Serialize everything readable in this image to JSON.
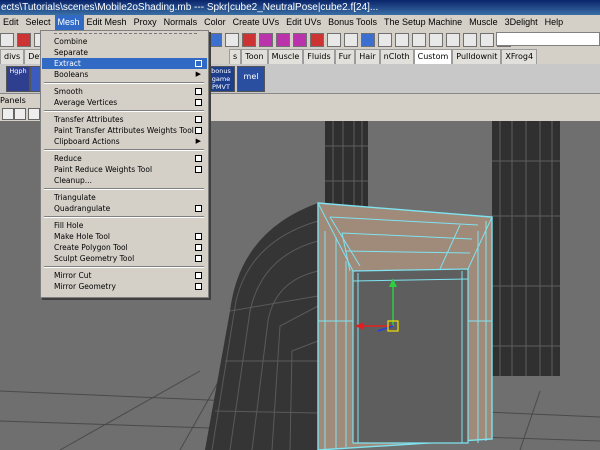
{
  "window": {
    "title": "ects\\Tutorials\\scenes\\Mobile2oShading.mb   ---   Spkr|cube2_NeutralPose|cube2.f[24]..."
  },
  "menubar": {
    "items": [
      {
        "label": "Edit"
      },
      {
        "label": "Select"
      },
      {
        "label": "Mesh"
      },
      {
        "label": "Edit Mesh"
      },
      {
        "label": "Proxy"
      },
      {
        "label": "Normals"
      },
      {
        "label": "Color"
      },
      {
        "label": "Create UVs"
      },
      {
        "label": "Edit UVs"
      },
      {
        "label": "Bonus Tools"
      },
      {
        "label": "The Setup Machine"
      },
      {
        "label": "Muscle"
      },
      {
        "label": "3Delight"
      },
      {
        "label": "Help"
      }
    ],
    "active_label": "Mesh"
  },
  "shelf_tabs": {
    "left": [
      {
        "label": "divs"
      },
      {
        "label": "Deform"
      }
    ],
    "right": [
      {
        "label": "s"
      },
      {
        "label": "Toon"
      },
      {
        "label": "Muscle"
      },
      {
        "label": "Fluids"
      },
      {
        "label": "Fur"
      },
      {
        "label": "Hair"
      },
      {
        "label": "nCloth"
      },
      {
        "label": "Custom"
      },
      {
        "label": "Pulldownit"
      },
      {
        "label": "XFrog4"
      }
    ],
    "selected_label": "Custom"
  },
  "shelf": {
    "left_btn": "Hgph",
    "bonus_btn": "bonus game PMVT",
    "mel_btn": "mel"
  },
  "panel_menu": {
    "label": "Panels"
  },
  "mesh_menu": {
    "items": [
      {
        "label": "Combine",
        "option": false,
        "submenu": false,
        "highlight": false
      },
      {
        "label": "Separate",
        "option": false,
        "submenu": false,
        "highlight": false
      },
      {
        "label": "Extract",
        "option": true,
        "submenu": false,
        "highlight": true
      },
      {
        "label": "Booleans",
        "option": false,
        "submenu": true,
        "highlight": false
      },
      {
        "label": "Smooth",
        "option": true,
        "submenu": false,
        "highlight": false
      },
      {
        "label": "Average Vertices",
        "option": true,
        "submenu": false,
        "highlight": false
      },
      {
        "label": "Transfer Attributes",
        "option": true,
        "submenu": false,
        "highlight": false
      },
      {
        "label": "Paint Transfer Attributes Weights Tool",
        "option": true,
        "submenu": false,
        "highlight": false
      },
      {
        "label": "Clipboard Actions",
        "option": false,
        "submenu": true,
        "highlight": false
      },
      {
        "label": "Reduce",
        "option": true,
        "submenu": false,
        "highlight": false
      },
      {
        "label": "Paint Reduce Weights Tool",
        "option": true,
        "submenu": false,
        "highlight": false
      },
      {
        "label": "Cleanup...",
        "option": false,
        "submenu": false,
        "highlight": false
      },
      {
        "label": "Triangulate",
        "option": false,
        "submenu": false,
        "highlight": false
      },
      {
        "label": "Quadrangulate",
        "option": true,
        "submenu": false,
        "highlight": false
      },
      {
        "label": "Fill Hole",
        "option": false,
        "submenu": false,
        "highlight": false
      },
      {
        "label": "Make Hole Tool",
        "option": true,
        "submenu": false,
        "highlight": false
      },
      {
        "label": "Create Polygon Tool",
        "option": true,
        "submenu": false,
        "highlight": false
      },
      {
        "label": "Sculpt Geometry Tool",
        "option": true,
        "submenu": false,
        "highlight": false
      },
      {
        "label": "Mirror Cut",
        "option": true,
        "submenu": false,
        "highlight": false
      },
      {
        "label": "Mirror Geometry",
        "option": true,
        "submenu": false,
        "highlight": false
      }
    ]
  },
  "colors": {
    "menu_highlight": "#316ac5",
    "wire_selected": "#7fe3f0",
    "mesh_fill": "#a08a7a",
    "column": "#3c3c3c",
    "viewport_bg": "#6f6f6f"
  },
  "icons": [
    "tear-off-icon",
    "option-box-icon",
    "submenu-arrow-icon",
    "move-manipulator-icon"
  ]
}
